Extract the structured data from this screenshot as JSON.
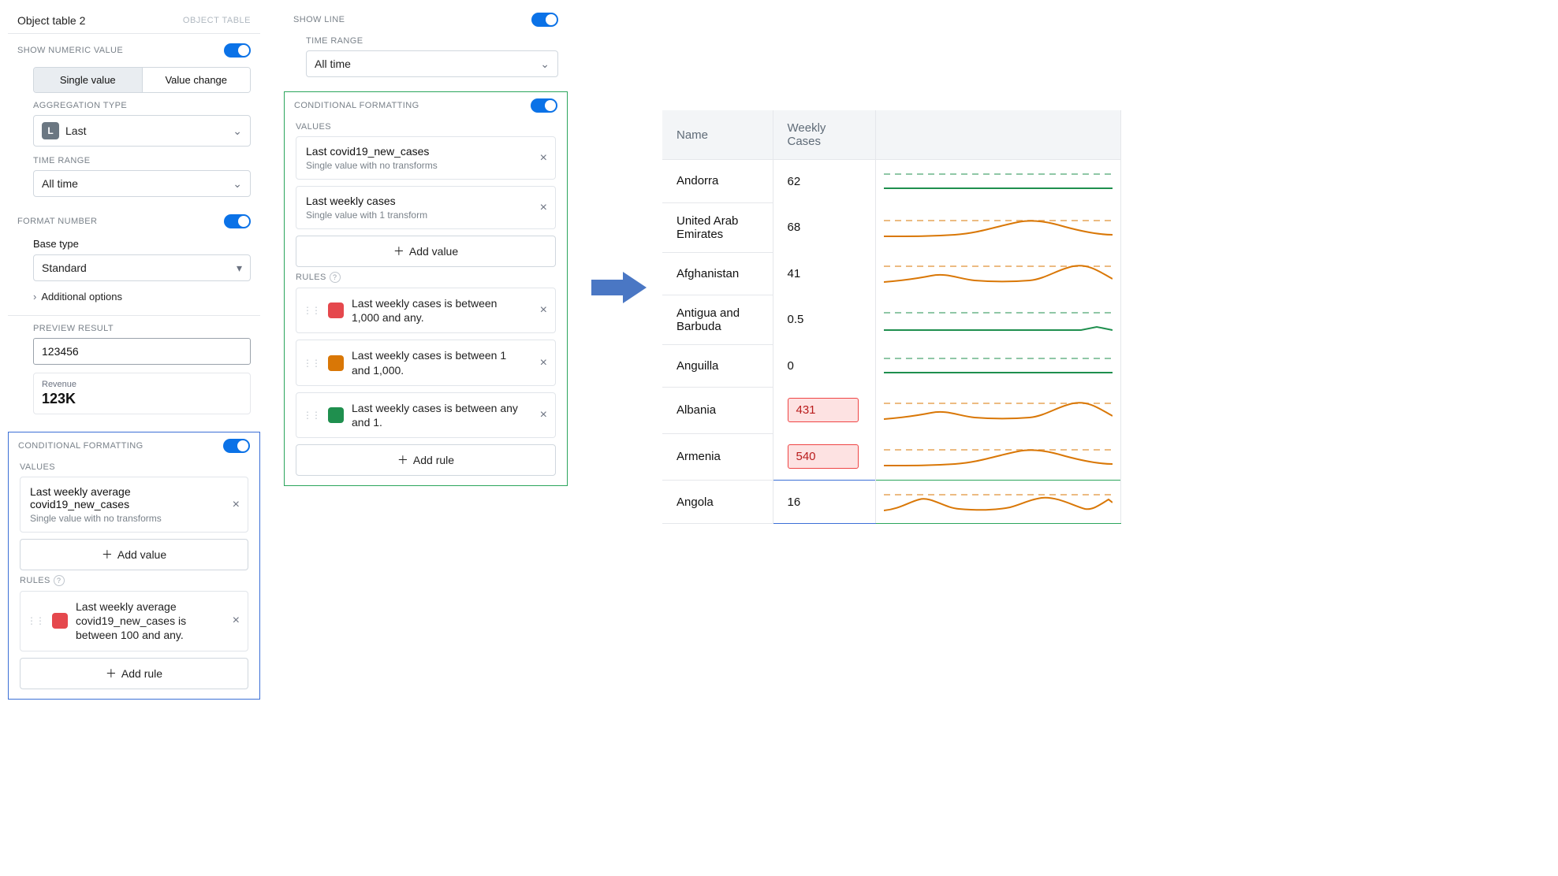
{
  "left": {
    "header_title": "Object table 2",
    "header_label": "OBJECT TABLE",
    "show_numeric_value": "SHOW NUMERIC VALUE",
    "seg": {
      "single": "Single value",
      "change": "Value change"
    },
    "agg_type_label": "AGGREGATION TYPE",
    "agg_type_value": "Last",
    "time_range_label": "TIME RANGE",
    "time_range_value": "All time",
    "format_number": "FORMAT NUMBER",
    "base_type_label": "Base type",
    "base_type_value": "Standard",
    "addl_options": "Additional options",
    "preview_label": "PREVIEW RESULT",
    "preview_input": "123456",
    "preview_card_title": "Revenue",
    "preview_card_value": "123K",
    "cf_label": "CONDITIONAL FORMATTING",
    "values_label": "VALUES",
    "value1_title": "Last weekly average covid19_new_cases",
    "value1_sub": "Single value with no transforms",
    "add_value": "Add value",
    "rules_label": "RULES",
    "rule1_text": "Last weekly average covid19_new_cases is between 100 and any.",
    "rule1_color": "#e5484d",
    "add_rule": "Add rule"
  },
  "mid": {
    "show_line": "SHOW LINE",
    "time_range_label": "TIME RANGE",
    "time_range_value": "All time",
    "cf_label": "CONDITIONAL FORMATTING",
    "values_label": "VALUES",
    "value1_title": "Last covid19_new_cases",
    "value1_sub": "Single value with no transforms",
    "value2_title": "Last weekly cases",
    "value2_sub": "Single value with 1 transform",
    "add_value": "Add value",
    "rules_label": "RULES",
    "rules": [
      {
        "text": "Last weekly cases is between 1,000 and any.",
        "color": "#e5484d"
      },
      {
        "text": "Last weekly cases is between 1 and 1,000.",
        "color": "#d97706"
      },
      {
        "text": "Last weekly cases is between any and 1.",
        "color": "#1f8f4e"
      }
    ],
    "add_rule": "Add rule"
  },
  "table": {
    "headers": {
      "name": "Name",
      "cases": "Weekly Cases"
    },
    "rows": [
      {
        "name": "Andorra",
        "cases": "62",
        "hl": false,
        "color": "#1f8f4e",
        "shape": "flat"
      },
      {
        "name": "United Arab Emirates",
        "cases": "68",
        "hl": false,
        "color": "#d97706",
        "shape": "bump"
      },
      {
        "name": "Afghanistan",
        "cases": "41",
        "hl": false,
        "color": "#d97706",
        "shape": "wave"
      },
      {
        "name": "Antigua and Barbuda",
        "cases": "0.5",
        "hl": false,
        "color": "#1f8f4e",
        "shape": "flatlow"
      },
      {
        "name": "Anguilla",
        "cases": "0",
        "hl": false,
        "color": "#1f8f4e",
        "shape": "flat"
      },
      {
        "name": "Albania",
        "cases": "431",
        "hl": true,
        "color": "#d97706",
        "shape": "wave"
      },
      {
        "name": "Armenia",
        "cases": "540",
        "hl": true,
        "color": "#d97706",
        "shape": "bump"
      },
      {
        "name": "Angola",
        "cases": "16",
        "hl": false,
        "color": "#d97706",
        "shape": "multi"
      }
    ]
  }
}
